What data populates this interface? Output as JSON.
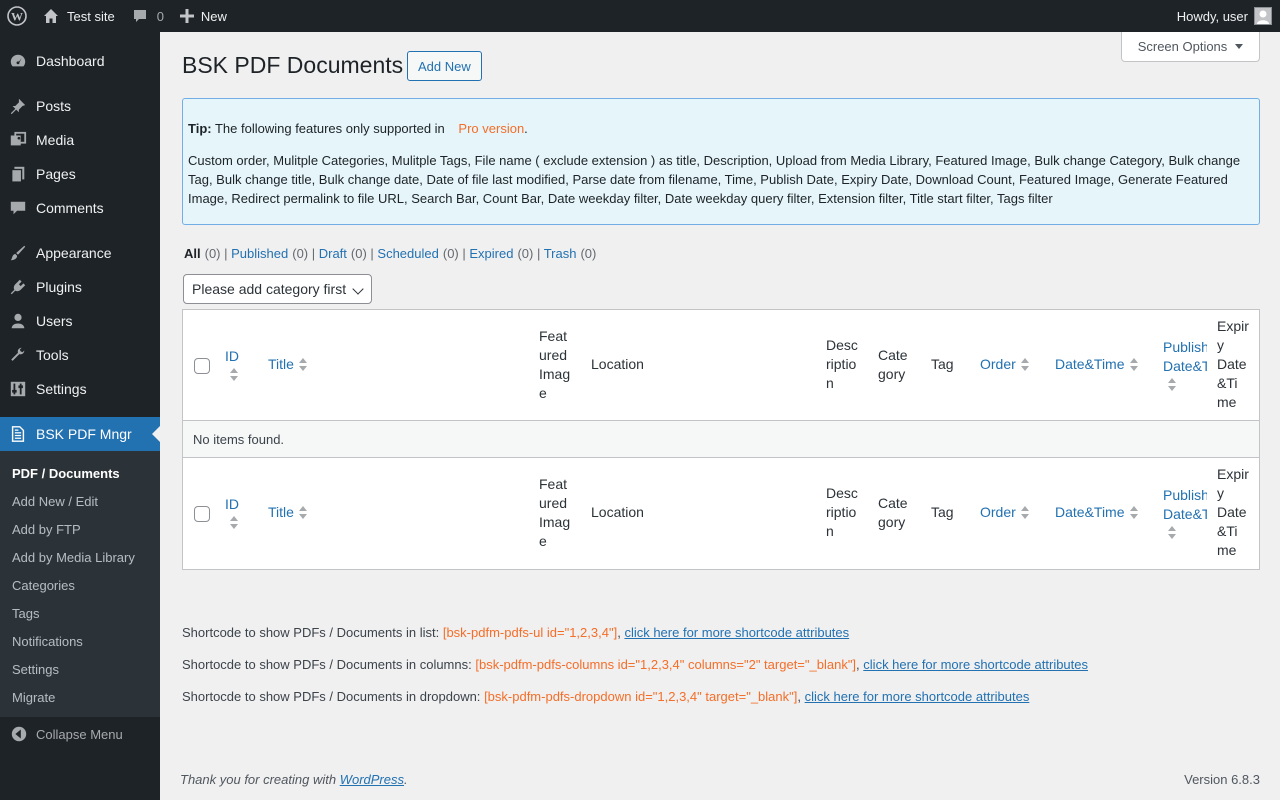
{
  "adminbar": {
    "site_name": "Test site",
    "comments_count": "0",
    "new_label": "New",
    "howdy": "Howdy, user"
  },
  "sidebar": {
    "items": [
      {
        "label": "Dashboard",
        "icon": "dashboard-icon"
      },
      {
        "label": "Posts",
        "icon": "pin-icon"
      },
      {
        "label": "Media",
        "icon": "media-icon"
      },
      {
        "label": "Pages",
        "icon": "pages-icon"
      },
      {
        "label": "Comments",
        "icon": "comment-icon"
      },
      {
        "label": "Appearance",
        "icon": "brush-icon"
      },
      {
        "label": "Plugins",
        "icon": "plugin-icon"
      },
      {
        "label": "Users",
        "icon": "user-icon"
      },
      {
        "label": "Tools",
        "icon": "wrench-icon"
      },
      {
        "label": "Settings",
        "icon": "settings-icon"
      },
      {
        "label": "BSK PDF Mngr",
        "icon": "document-icon"
      }
    ],
    "submenu": [
      "PDF / Documents",
      "Add New / Edit",
      "Add by FTP",
      "Add by Media Library",
      "Categories",
      "Tags",
      "Notifications",
      "Settings",
      "Migrate"
    ],
    "collapse_label": "Collapse Menu"
  },
  "header": {
    "screen_options": "Screen Options",
    "title": "BSK PDF Documents",
    "add_new": "Add New"
  },
  "tip": {
    "label": "Tip:",
    "text": "The following features only supported in",
    "pro_link": "Pro version",
    "period": ".",
    "features": "Custom order, Mulitple Categories, Mulitple Tags, File name ( exclude extension ) as title, Description, Upload from Media Library, Featured Image, Bulk change Category, Bulk change Tag, Bulk change title, Bulk change date, Date of file last modified, Parse date from filename, Time, Publish Date, Expiry Date, Download Count, Featured Image, Generate Featured Image, Redirect permalink to file URL, Search Bar, Count Bar, Date weekday filter, Date weekday query filter, Extension filter, Title start filter, Tags filter"
  },
  "views": [
    {
      "label": "All",
      "count": "(0)"
    },
    {
      "label": "Published",
      "count": "(0)"
    },
    {
      "label": "Draft",
      "count": "(0)"
    },
    {
      "label": "Scheduled",
      "count": "(0)"
    },
    {
      "label": "Expired",
      "count": "(0)"
    },
    {
      "label": "Trash",
      "count": "(0)"
    }
  ],
  "category_select": "Please add category first",
  "table": {
    "col_id": "ID",
    "col_title": "Title",
    "col_featured": [
      "Feat",
      "ured",
      "Imag",
      "e"
    ],
    "col_location": "Location",
    "col_description": [
      "Desc",
      "riptio",
      "n"
    ],
    "col_category": [
      "Cate",
      "gory"
    ],
    "col_tag": "Tag",
    "col_order": "Order",
    "col_datetime": "Date&Time",
    "col_publish": [
      "Publish",
      "Date&T"
    ],
    "col_expiry": [
      "Expir",
      "y",
      "Date",
      "&Ti",
      "me"
    ],
    "empty": "No items found."
  },
  "shortcodes": [
    {
      "text": "Shortcode to show PDFs / Documents in list:",
      "code": "[bsk-pdfm-pdfs-ul id=\"1,2,3,4\"]",
      "sep": ",",
      "link": "click here for more shortcode attributes"
    },
    {
      "text": "Shortocde to show PDFs / Documents in columns:",
      "code": "[bsk-pdfm-pdfs-columns id=\"1,2,3,4\" columns=\"2\" target=\"_blank\"]",
      "sep": ",",
      "link": "click here for more shortcode attributes"
    },
    {
      "text": "Shortocde to show PDFs / Documents in dropdown:",
      "code": "[bsk-pdfm-pdfs-dropdown id=\"1,2,3,4\" target=\"_blank\"]",
      "sep": ",",
      "link": "click here for more shortcode attributes"
    }
  ],
  "footer": {
    "thanks_prefix": "Thank you for creating with",
    "thanks_link": "WordPress",
    "thanks_suffix": ".",
    "version": "Version 6.8.3"
  },
  "colors": {
    "adminbar_bg": "#1d2327",
    "accent": "#2271b1",
    "pro_orange": "#f56e28",
    "tip_bg": "#e5f5fa"
  }
}
